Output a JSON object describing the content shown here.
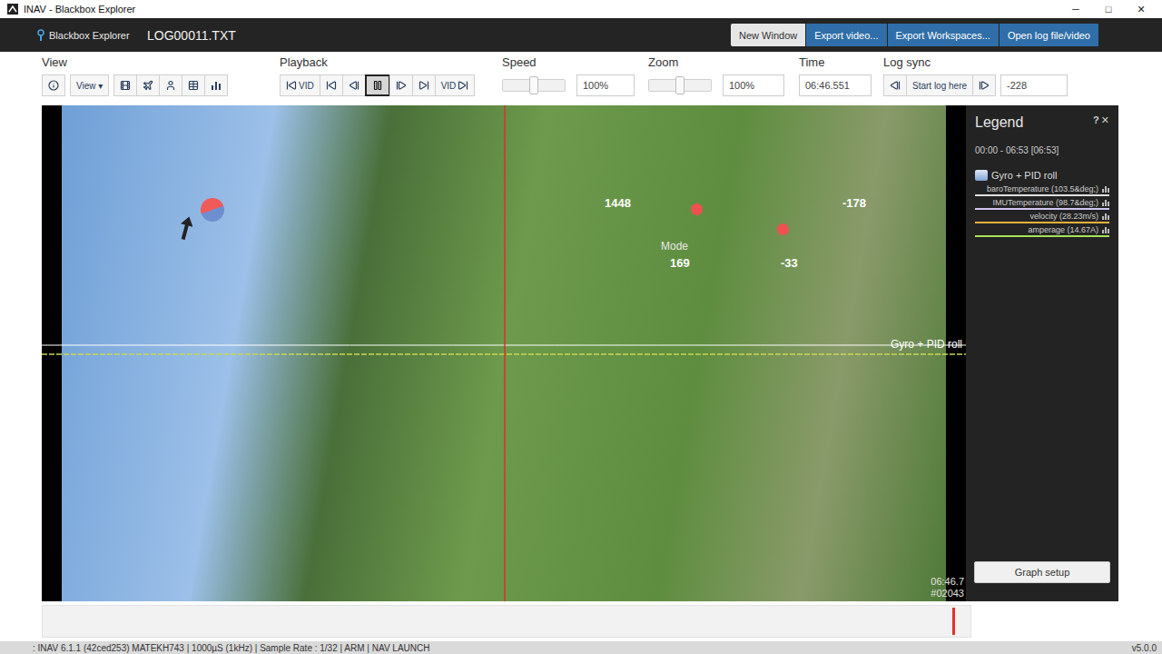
{
  "window": {
    "title": "INAV - Blackbox Explorer",
    "controls": [
      "─",
      "□",
      "✕"
    ]
  },
  "header": {
    "logo": "Blackbox Explorer",
    "file": "LOG00011.TXT",
    "buttons": [
      {
        "label": "New Window",
        "kind": "light"
      },
      {
        "label": "Export video...",
        "kind": "primary"
      },
      {
        "label": "Export Workspaces...",
        "kind": "primary"
      },
      {
        "label": "Open log file/video",
        "kind": "primary"
      }
    ]
  },
  "toolbar": {
    "view": {
      "label": "View",
      "buttons": [
        {
          "kind": "info"
        },
        {
          "kind": "dropdown",
          "text": "View",
          "caret": "▾"
        },
        {
          "kind": "video"
        },
        {
          "kind": "craft"
        },
        {
          "kind": "sticks"
        },
        {
          "kind": "table"
        },
        {
          "kind": "chart"
        }
      ]
    },
    "playback": {
      "label": "Playback",
      "buttons": [
        {
          "kind": "skip-back",
          "text": "VID",
          "selected": false
        },
        {
          "kind": "skip-back",
          "selected": false
        },
        {
          "kind": "step-back",
          "selected": false
        },
        {
          "kind": "pause",
          "selected": true
        },
        {
          "kind": "step-forward",
          "selected": false
        },
        {
          "kind": "skip-forward",
          "selected": false
        },
        {
          "kind": "skip-forward-vid",
          "text": "VID",
          "selected": false
        }
      ]
    },
    "speed": {
      "label": "Speed",
      "level": 0.5,
      "value": "100%"
    },
    "zoom": {
      "label": "Zoom",
      "level": 0.5,
      "value": "100%"
    },
    "time": {
      "label": "Time",
      "value": "06:46.551"
    },
    "log_sync": {
      "label": "Log sync",
      "buttons": [
        {
          "kind": "step-back"
        },
        {
          "kind": "text",
          "text": "Start log here"
        },
        {
          "kind": "step-forward"
        }
      ],
      "value": "-228"
    }
  },
  "video": {
    "sticks": [
      {
        "text": "1448"
      },
      {
        "text": "169"
      },
      {
        "text": "-178"
      },
      {
        "text": "-33"
      }
    ],
    "mode": "Mode",
    "graph": {
      "label": "Gyro + PID roll",
      "series": [
        {
          "color": "#ffffff",
          "values": [
            0,
            0,
            0,
            0,
            0,
            0,
            0,
            0,
            0,
            0
          ]
        },
        {
          "color": "#c8d850",
          "values": [
            10,
            10,
            10,
            10,
            10,
            10,
            10,
            10,
            10,
            10
          ]
        }
      ]
    },
    "cursor": {
      "level": 0.5
    },
    "time": "06:46.7",
    "frame": "#02043"
  },
  "legend": {
    "title": "Legend",
    "help": "?",
    "close": "✕",
    "range": "00:00 - 06:53 [06:53]",
    "groups": [
      {
        "name": "Gyro + PID roll",
        "items": [
          {
            "name": "baroTemperature (103.5&deg;)",
            "color": "#e0e0e0"
          },
          {
            "name": "IMUTemperature (98.7&deg;)",
            "color": "#cfc4ef"
          },
          {
            "name": "velocity (28.23m/s)",
            "color": "#f2b13c"
          },
          {
            "name": "amperage (14.67A)",
            "color": "#a8e05a"
          }
        ]
      }
    ],
    "button": "Graph setup"
  },
  "timeline": {
    "level": 0.98
  },
  "status_bar": {
    "text": ": INAV 6.1.1 (42ced253) MATEKH743 | 1000µS (1kHz) | Sample Rate : 1/32 | ARM | NAV LAUNCH",
    "version": "v5.0.0"
  }
}
